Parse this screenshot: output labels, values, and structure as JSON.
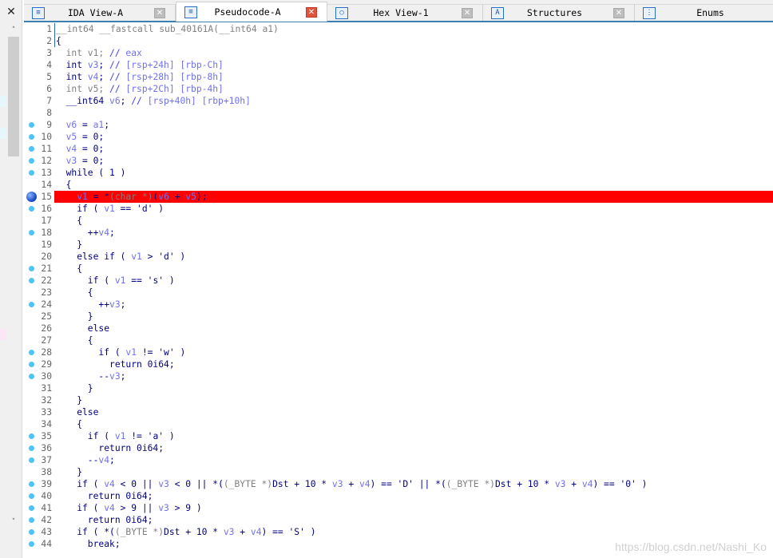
{
  "left_panel": {
    "close_label": "✕",
    "scroll_up": "˄",
    "scroll_down": "˅"
  },
  "tabs": [
    {
      "label": "IDA View-A",
      "icon": "ida-view-icon",
      "glyph": "≡",
      "active": false
    },
    {
      "label": "Pseudocode-A",
      "icon": "pseudocode-icon",
      "glyph": "≡",
      "active": true
    },
    {
      "label": "Hex View-1",
      "icon": "hex-view-icon",
      "glyph": "○",
      "active": false
    },
    {
      "label": "Structures",
      "icon": "structures-icon",
      "glyph": "A",
      "active": false
    },
    {
      "label": "Enums",
      "icon": "enums-icon",
      "glyph": "⋮",
      "active": false
    }
  ],
  "tab_close_glyph": "✕",
  "highlight_color": "#ff0000",
  "current_line": 15,
  "code": [
    {
      "n": "1",
      "text": "__int64 __fastcall sub_40161A(__int64 a1)",
      "dim": true
    },
    {
      "n": "2",
      "text": "{"
    },
    {
      "n": "3",
      "text": "  int v1; // eax",
      "dim": true
    },
    {
      "n": "4",
      "text": "  int v3; // [rsp+24h] [rbp-Ch]"
    },
    {
      "n": "5",
      "text": "  int v4; // [rsp+28h] [rbp-8h]"
    },
    {
      "n": "6",
      "text": "  int v5; // [rsp+2Ch] [rbp-4h]",
      "dim": true
    },
    {
      "n": "7",
      "text": "  __int64 v6; // [rsp+40h] [rbp+10h]"
    },
    {
      "n": "8",
      "text": ""
    },
    {
      "n": "9",
      "text": "  v6 = a1;",
      "bp": true
    },
    {
      "n": "10",
      "text": "  v5 = 0;",
      "bp": true
    },
    {
      "n": "11",
      "text": "  v4 = 0;",
      "bp": true
    },
    {
      "n": "12",
      "text": "  v3 = 0;",
      "bp": true
    },
    {
      "n": "13",
      "text": "  while ( 1 )",
      "bp": true
    },
    {
      "n": "14",
      "text": "  {"
    },
    {
      "n": "15",
      "text": "    v1 = *(char *)(v6 + v5);",
      "bp": true,
      "current": true
    },
    {
      "n": "16",
      "text": "    if ( v1 == 'd' )",
      "bp": true
    },
    {
      "n": "17",
      "text": "    {"
    },
    {
      "n": "18",
      "text": "      ++v4;",
      "bp": true
    },
    {
      "n": "19",
      "text": "    }"
    },
    {
      "n": "20",
      "text": "    else if ( v1 > 'd' )"
    },
    {
      "n": "21",
      "text": "    {",
      "bp": true
    },
    {
      "n": "22",
      "text": "      if ( v1 == 's' )",
      "bp": true
    },
    {
      "n": "23",
      "text": "      {"
    },
    {
      "n": "24",
      "text": "        ++v3;",
      "bp": true
    },
    {
      "n": "25",
      "text": "      }"
    },
    {
      "n": "26",
      "text": "      else"
    },
    {
      "n": "27",
      "text": "      {"
    },
    {
      "n": "28",
      "text": "        if ( v1 != 'w' )",
      "bp": true
    },
    {
      "n": "29",
      "text": "          return 0i64;",
      "bp": true
    },
    {
      "n": "30",
      "text": "        --v3;",
      "bp": true
    },
    {
      "n": "31",
      "text": "      }"
    },
    {
      "n": "32",
      "text": "    }"
    },
    {
      "n": "33",
      "text": "    else"
    },
    {
      "n": "34",
      "text": "    {"
    },
    {
      "n": "35",
      "text": "      if ( v1 != 'a' )",
      "bp": true
    },
    {
      "n": "36",
      "text": "        return 0i64;",
      "bp": true
    },
    {
      "n": "37",
      "text": "      --v4;",
      "bp": true
    },
    {
      "n": "38",
      "text": "    }"
    },
    {
      "n": "39",
      "text": "    if ( v4 < 0 || v3 < 0 || *((_BYTE *)Dst + 10 * v3 + v4) == 'D' || *((_BYTE *)Dst + 10 * v3 + v4) == '0' )",
      "bp": true
    },
    {
      "n": "40",
      "text": "      return 0i64;",
      "bp": true
    },
    {
      "n": "41",
      "text": "    if ( v4 > 9 || v3 > 9 )",
      "bp": true
    },
    {
      "n": "42",
      "text": "      return 0i64;",
      "bp": true
    },
    {
      "n": "43",
      "text": "    if ( *((_BYTE *)Dst + 10 * v3 + v4) == 'S' )",
      "bp": true
    },
    {
      "n": "44",
      "text": "      break;",
      "bp": true
    }
  ],
  "watermark": "https://blog.csdn.net/Nashi_Ko"
}
